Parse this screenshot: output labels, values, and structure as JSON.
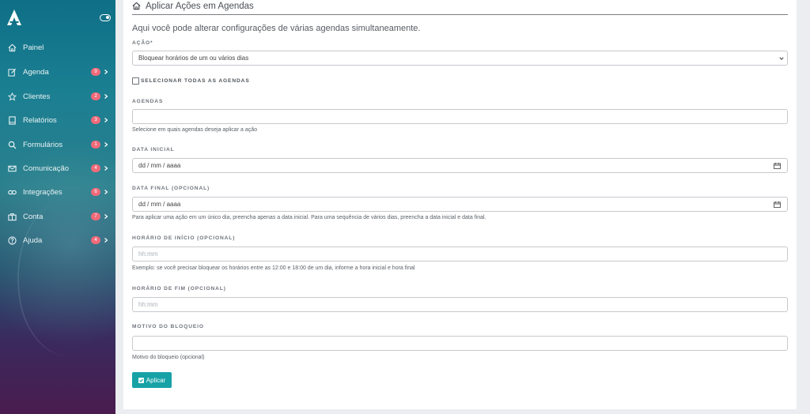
{
  "sidebar": {
    "items": [
      {
        "label": "Painel",
        "icon": "home-icon"
      },
      {
        "label": "Agenda",
        "icon": "edit-icon",
        "badge": "9"
      },
      {
        "label": "Clientes",
        "icon": "star-icon",
        "badge": "2"
      },
      {
        "label": "Relatórios",
        "icon": "book-icon",
        "badge": "3"
      },
      {
        "label": "Formulários",
        "icon": "search-icon",
        "badge": "1"
      },
      {
        "label": "Comunicação",
        "icon": "mail-icon",
        "badge": "4"
      },
      {
        "label": "Integrações",
        "icon": "link-icon",
        "badge": "6"
      },
      {
        "label": "Conta",
        "icon": "briefcase-icon",
        "badge": "7"
      },
      {
        "label": "Ajuda",
        "icon": "help-icon",
        "badge": "4"
      }
    ]
  },
  "page": {
    "title": "Aplicar Ações em Agendas",
    "subtitle": "Aqui você pode alterar configurações de várias agendas simultaneamente."
  },
  "form": {
    "acao_label": "AÇÃO*",
    "acao_value": "Bloquear horários de um ou vários dias",
    "select_all_label": "SELECIONAR TODAS AS AGENDAS",
    "agendas_label": "AGENDAS",
    "agendas_help": "Selecione em quais agendas deseja aplicar a ação",
    "data_inicial_label": "DATA INICIAL",
    "data_inicial_value": "dd / mm / aaaa",
    "data_final_label": "DATA FINAL (OPCIONAL)",
    "data_final_value": "dd / mm / aaaa",
    "data_final_help": "Para aplicar uma ação em um único dia, preencha apenas a data inicial. Para uma sequência de vários dias, preencha a data inicial e data final.",
    "hora_inicio_label": "HORÁRIO DE INÍCIO (OPCIONAL)",
    "hora_inicio_placeholder": "hh:mm",
    "hora_inicio_help": "Exemplo: se você precisar bloquear os horários entre as 12:00 e 18:00 de um dia, informe a hora inicial e hora final",
    "hora_fim_label": "HORÁRIO DE FIM (OPCIONAL)",
    "hora_fim_placeholder": "hh:mm",
    "motivo_label": "MOTIVO DO BLOQUEIO",
    "motivo_help": "Motivo do bloqueio (opcional)",
    "submit_label": "Aplicar"
  },
  "colors": {
    "accent": "#17a2a6",
    "badge": "#f06a7a"
  }
}
